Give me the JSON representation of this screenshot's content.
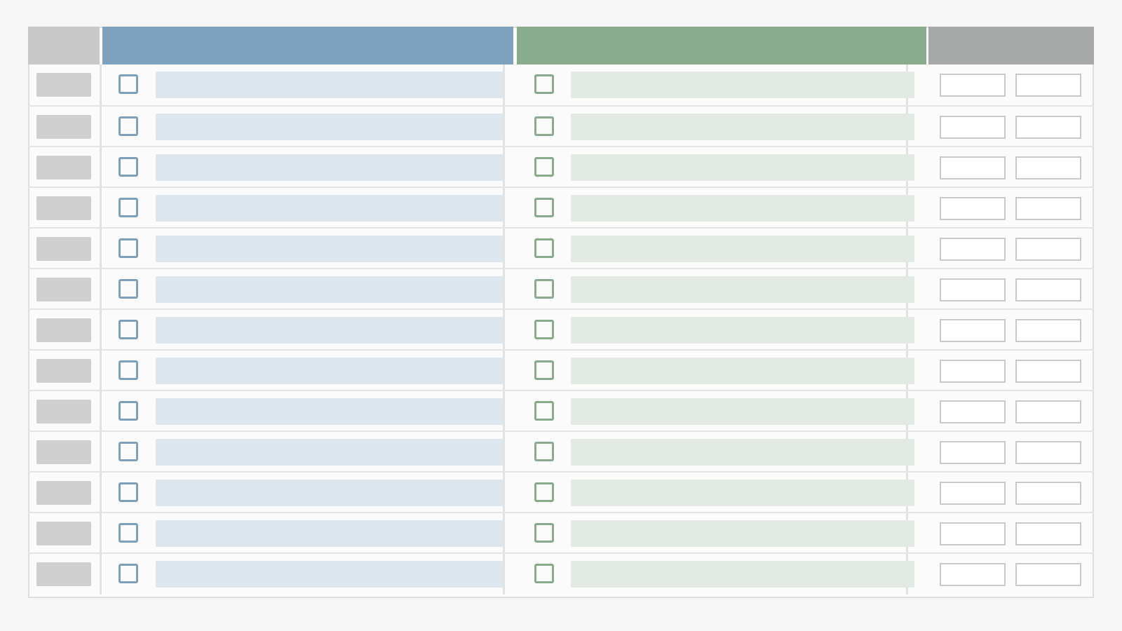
{
  "colors": {
    "header_index": "#c8c8c8",
    "header_group_a": "#7ea2bd",
    "header_group_b": "#89ad8c",
    "header_actions": "#a7aaa8",
    "checkbox_a_border": "#7fa0b8",
    "checkbox_b_border": "#8aa98d",
    "bar_a_fill": "#dde6ed",
    "bar_b_fill": "#e3e9e3",
    "index_cell_fill": "#cfcfcf"
  },
  "icons": {
    "checkbox": "checkbox-icon"
  },
  "table": {
    "columns": [
      "",
      "",
      "",
      ""
    ],
    "rows": [
      {
        "a_checked": false,
        "b_checked": false
      },
      {
        "a_checked": false,
        "b_checked": false
      },
      {
        "a_checked": false,
        "b_checked": false
      },
      {
        "a_checked": false,
        "b_checked": false
      },
      {
        "a_checked": false,
        "b_checked": false
      },
      {
        "a_checked": false,
        "b_checked": false
      },
      {
        "a_checked": false,
        "b_checked": false
      },
      {
        "a_checked": false,
        "b_checked": false
      },
      {
        "a_checked": false,
        "b_checked": false
      },
      {
        "a_checked": false,
        "b_checked": false
      },
      {
        "a_checked": false,
        "b_checked": false
      },
      {
        "a_checked": false,
        "b_checked": false
      },
      {
        "a_checked": false,
        "b_checked": false
      }
    ]
  }
}
